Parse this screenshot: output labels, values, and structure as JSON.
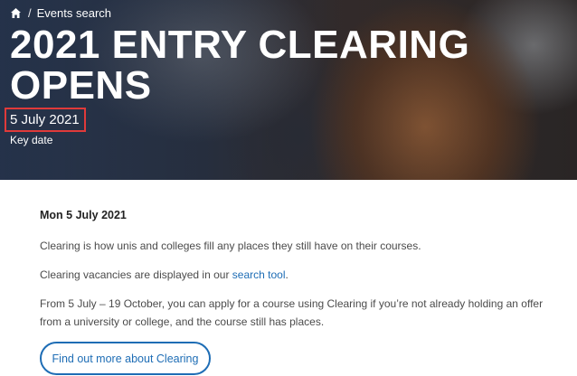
{
  "breadcrumb": {
    "home_icon": "home-icon",
    "separator": "/",
    "current": "Events search"
  },
  "hero": {
    "title": "2021 ENTRY CLEARING OPENS",
    "date": "5 July 2021",
    "date_type": "Key date",
    "highlight_color": "#e03a3a"
  },
  "content": {
    "heading": "Mon 5 July 2021",
    "para1": "Clearing is how unis and colleges fill any places they still have on their courses.",
    "para2_prefix": "Clearing vacancies are displayed in our ",
    "para2_link": "search tool",
    "para2_suffix": ".",
    "para3": "From 5 July – 19 October, you can apply for a course using Clearing if you’re not already holding an offer from a university or college, and the course still has places.",
    "cta_label": "Find out more about Clearing",
    "accent_color": "#1e6db5"
  }
}
